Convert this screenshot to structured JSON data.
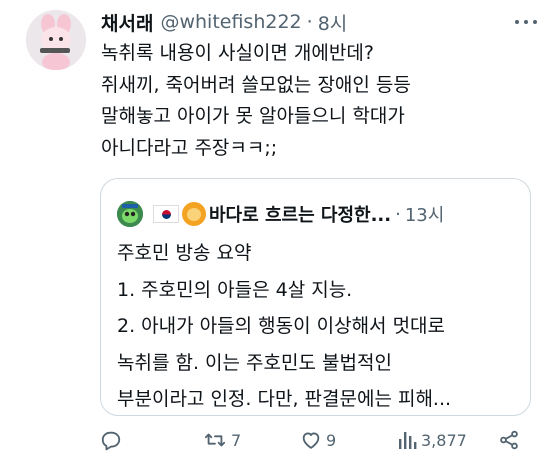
{
  "tweet": {
    "display_name": "채서래",
    "handle": "@whitefish222",
    "separator": "·",
    "time": "8시",
    "text_lines": [
      "녹취록 내용이 사실이면 개에반데?",
      "쥐새끼, 죽어버려 쓸모없는 장애인 등등",
      "말해놓고 아이가 못 알아들으니 학대가",
      "아니다라고 주장ㅋㅋ;;"
    ]
  },
  "quote": {
    "display_name": "바다로 흐르는 다정한...",
    "separator": "·",
    "time": "13시",
    "text_lines": [
      "주호민 방송 요약",
      "1. 주호민의 아들은 4살 지능.",
      "2. 아내가 아들의 행동이 이상해서 멋대로",
      "녹취를 함. 이는 주호민도 불법적인",
      "부분이라고 인정. 다만, 판결문에는 피해..."
    ]
  },
  "actions": {
    "reply_count": "",
    "retweet_count": "7",
    "like_count": "9",
    "views_count": "3,877"
  },
  "icons": {
    "more": "more-horizontal-icon",
    "reply": "reply-bubble-icon",
    "retweet": "retweet-icon",
    "like": "heart-icon",
    "views": "views-bar-chart-icon",
    "share": "share-icon"
  },
  "colors": {
    "text": "#0f1419",
    "secondary": "#536471",
    "border": "#cfd9de"
  }
}
